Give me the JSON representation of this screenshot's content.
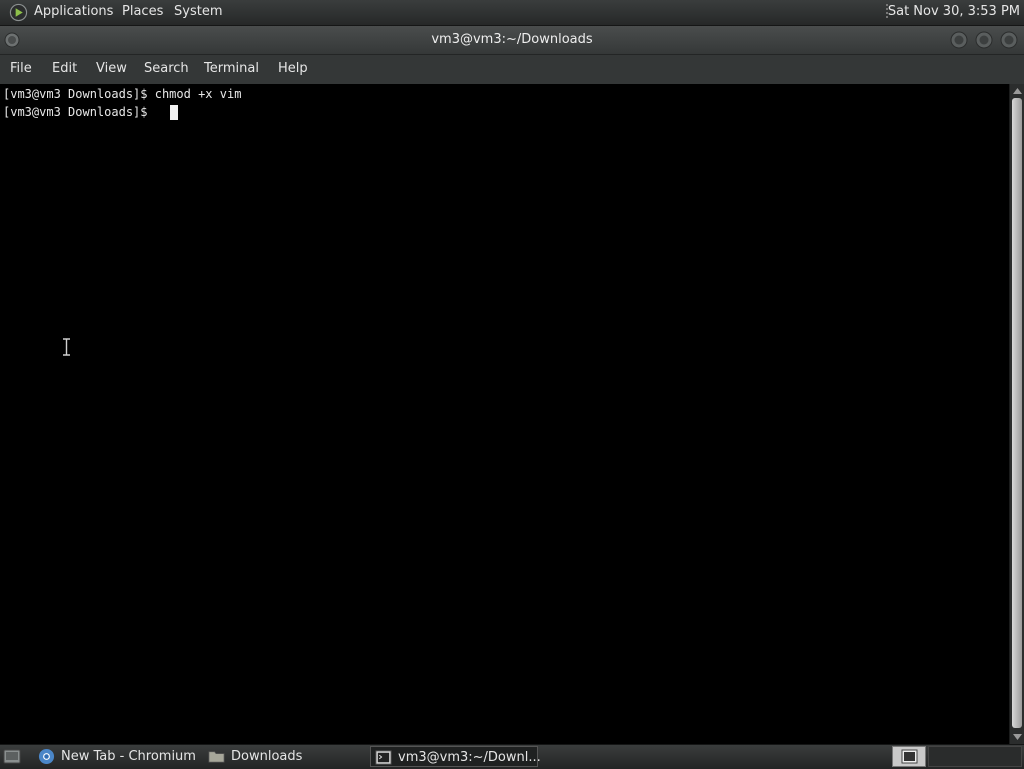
{
  "top_panel": {
    "menu": [
      "Applications",
      "Places",
      "System"
    ],
    "clock": "Sat Nov 30,  3:53 PM"
  },
  "window": {
    "title": "vm3@vm3:~/Downloads",
    "menu": [
      "File",
      "Edit",
      "View",
      "Search",
      "Terminal",
      "Help"
    ]
  },
  "terminal": {
    "lines": [
      "[vm3@vm3 Downloads]$ chmod +x vim",
      "[vm3@vm3 Downloads]$ "
    ]
  },
  "taskbar": {
    "tasks": [
      {
        "label": "New Tab - Chromium",
        "icon": "chromium-icon"
      },
      {
        "label": "Downloads",
        "icon": "folder-icon"
      },
      {
        "label": "vm3@vm3:~/Downl...",
        "icon": "terminal-icon"
      }
    ]
  },
  "colors": {
    "terminal_bg": "#000000",
    "terminal_fg": "#e8e8e8",
    "panel_bg": "#2f3232"
  }
}
